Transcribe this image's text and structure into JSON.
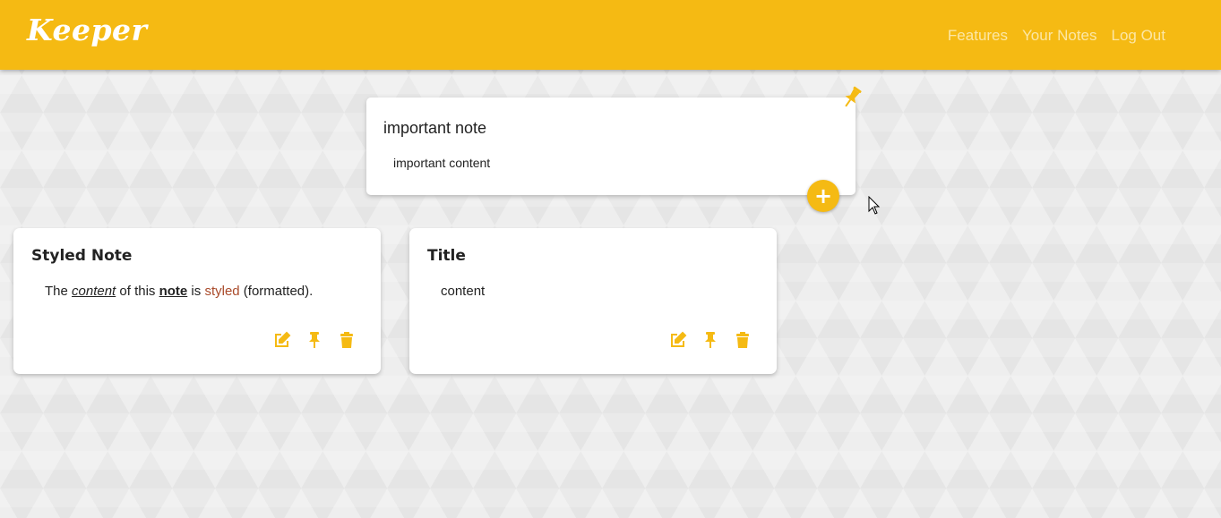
{
  "app": {
    "logo": "Keeper",
    "nav": [
      "Features",
      "Your Notes",
      "Log Out"
    ],
    "accent_color": "#f5ba13"
  },
  "composer": {
    "title": "important note",
    "content": "important content",
    "add_icon": "plus-icon",
    "pin_icon": "pushpin-icon"
  },
  "notes": [
    {
      "title": "Styled Note",
      "content_parts": [
        "The ",
        "content",
        " of this ",
        "note",
        " is ",
        "styled",
        " (formatted)."
      ],
      "actions": [
        "edit-icon",
        "pin-icon",
        "trash-icon"
      ]
    },
    {
      "title": "Title",
      "content": "content",
      "actions": [
        "edit-icon",
        "pin-icon",
        "trash-icon"
      ]
    }
  ]
}
